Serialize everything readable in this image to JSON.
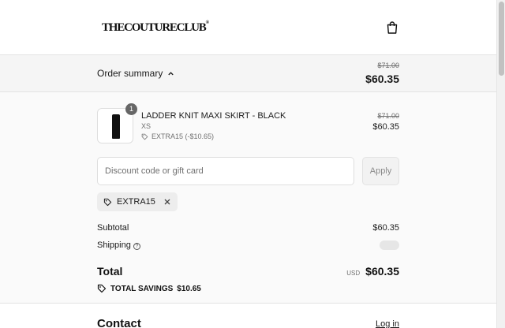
{
  "header": {
    "logo_text": "THECOUTURECLUB",
    "logo_mark": "®",
    "cart_icon": "shopping-bag-icon"
  },
  "summary_bar": {
    "toggle_label": "Order summary",
    "toggle_icon": "chevron-up-icon",
    "original_total": "$71.00",
    "total": "$60.35"
  },
  "line_item": {
    "quantity": "1",
    "name": "LADDER KNIT MAXI SKIRT - BLACK",
    "variant": "XS",
    "discount": "EXTRA15 (-$10.65)",
    "original_price": "$71.00",
    "price": "$60.35"
  },
  "discount": {
    "placeholder": "Discount code or gift card",
    "apply_label": "Apply",
    "applied_code": "EXTRA15"
  },
  "totals": {
    "subtotal_label": "Subtotal",
    "subtotal_value": "$60.35",
    "shipping_label": "Shipping",
    "shipping_help": "?",
    "total_label": "Total",
    "currency": "USD",
    "total_value": "$60.35",
    "savings_label": "TOTAL SAVINGS",
    "savings_value": "$10.65"
  },
  "contact": {
    "title": "Contact",
    "login_label": "Log in"
  },
  "colors": {
    "summary_bg": "#f5f5f5",
    "panel_bg": "#fafafa",
    "text": "#1a1a1a",
    "muted": "#707070"
  }
}
